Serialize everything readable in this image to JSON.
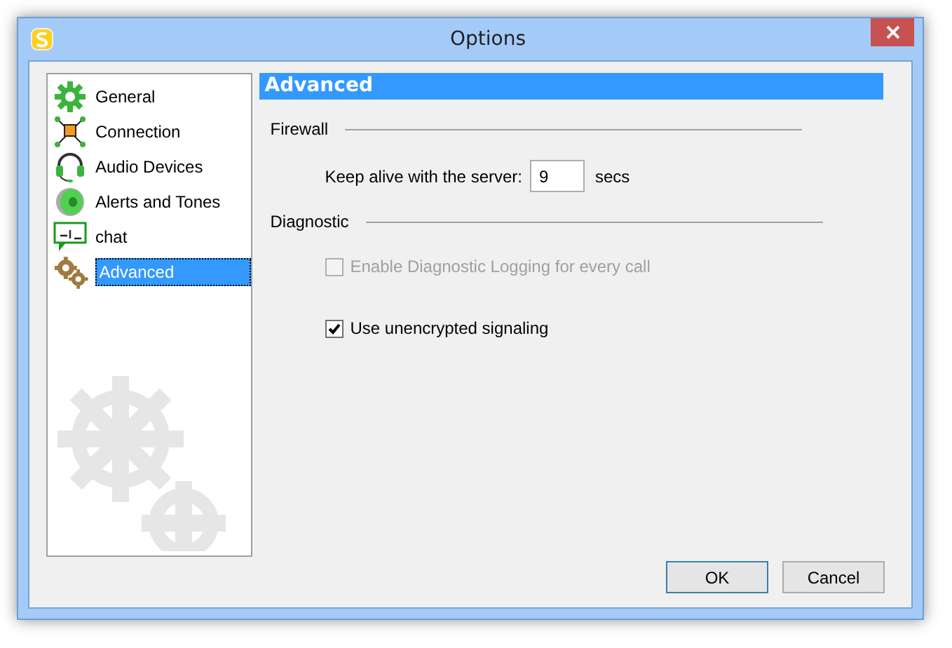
{
  "window": {
    "title": "Options"
  },
  "sidebar": {
    "items": [
      {
        "label": "General",
        "kind": "general",
        "selected": false
      },
      {
        "label": "Connection",
        "kind": "connection",
        "selected": false
      },
      {
        "label": "Audio Devices",
        "kind": "audio",
        "selected": false
      },
      {
        "label": "Alerts and Tones",
        "kind": "alerts",
        "selected": false
      },
      {
        "label": "chat",
        "kind": "chat",
        "selected": false
      },
      {
        "label": "Advanced",
        "kind": "advanced",
        "selected": true
      }
    ]
  },
  "panel": {
    "title": "Advanced",
    "sections": [
      {
        "title": "Firewall",
        "rows": [
          {
            "kind": "field",
            "label": "Keep alive with the server:",
            "value": "9",
            "unit": "secs"
          }
        ]
      },
      {
        "title": "Diagnostic",
        "rows": [
          {
            "kind": "checkbox",
            "label": "Enable Diagnostic Logging for every call",
            "checked": false,
            "disabled": true
          },
          {
            "kind": "checkbox",
            "label": "Use unencrypted signaling",
            "checked": true,
            "disabled": false
          }
        ]
      }
    ]
  },
  "buttons": [
    {
      "label": "OK",
      "default": true
    },
    {
      "label": "Cancel",
      "default": false
    }
  ]
}
